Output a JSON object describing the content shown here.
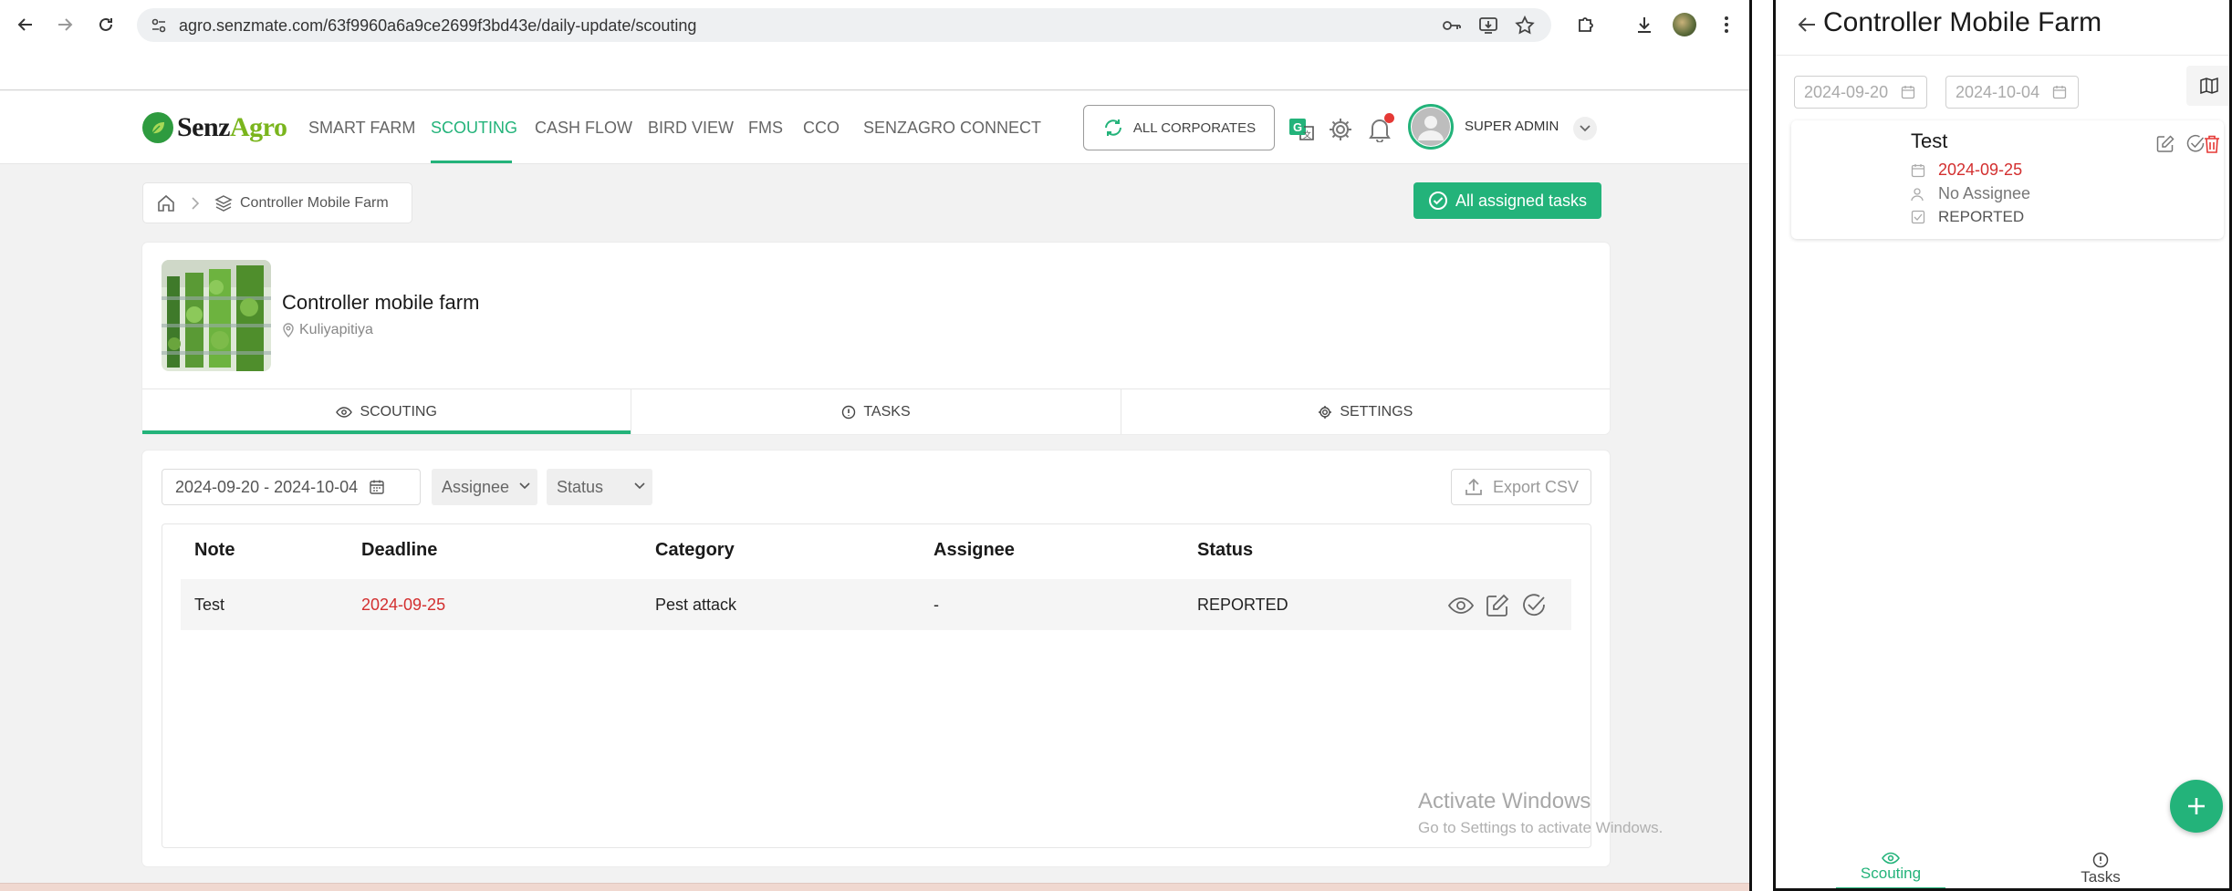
{
  "browser": {
    "url": "agro.senzmate.com/63f9960a6a9ce2699f3bd43e/daily-update/scouting"
  },
  "header": {
    "logo_part1": "Senz",
    "logo_part2": "Agro",
    "nav": [
      {
        "label": "SMART FARM"
      },
      {
        "label": "SCOUTING"
      },
      {
        "label": "CASH FLOW"
      },
      {
        "label": "BIRD VIEW"
      },
      {
        "label": "FMS"
      },
      {
        "label": "CCO"
      },
      {
        "label": "SENZAGRO CONNECT"
      }
    ],
    "active_nav": "SCOUTING",
    "all_corporates": "ALL CORPORATES",
    "user_name": "SUPER ADMIN"
  },
  "breadcrumb": {
    "label": "Controller Mobile Farm"
  },
  "assigned_button": "All assigned tasks",
  "farm": {
    "name": "Controller mobile farm",
    "location": "Kuliyapitiya"
  },
  "tabs": [
    {
      "label": "SCOUTING",
      "icon": "eye-icon"
    },
    {
      "label": "TASKS",
      "icon": "info-icon"
    },
    {
      "label": "SETTINGS",
      "icon": "gear-icon"
    }
  ],
  "filters": {
    "date_range": "2024-09-20 - 2024-10-04",
    "assignee": "Assignee",
    "status": "Status",
    "export": "Export CSV"
  },
  "table": {
    "columns": [
      "Note",
      "Deadline",
      "Category",
      "Assignee",
      "Status"
    ],
    "rows": [
      {
        "note": "Test",
        "deadline": "2024-09-25",
        "category": "Pest attack",
        "assignee": "-",
        "status": "REPORTED"
      }
    ]
  },
  "watermark": {
    "line1": "Activate Windows",
    "line2": "Go to Settings to activate Windows."
  },
  "mobile": {
    "title": "Controller Mobile Farm",
    "date_from": "2024-09-20",
    "date_to": "2024-10-04",
    "task": {
      "title": "Test",
      "deadline": "2024-09-25",
      "assignee": "No Assignee",
      "status": "REPORTED"
    },
    "bottom_nav": [
      {
        "label": "Scouting"
      },
      {
        "label": "Tasks"
      }
    ]
  },
  "colors": {
    "accent": "#23b37a",
    "deadline": "#d32f2f",
    "delete": "#e53935"
  }
}
